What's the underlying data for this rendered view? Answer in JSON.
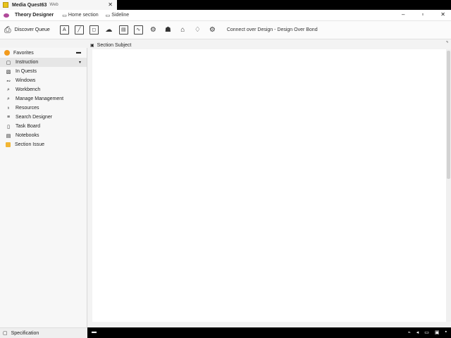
{
  "tab": {
    "title": "Media Quest63",
    "subtitle": "Web",
    "close_icon": "close-icon"
  },
  "menubar": {
    "app_name": "Theory Designer",
    "items": [
      {
        "label": "Home section",
        "icon": "window-icon"
      },
      {
        "label": "Sideline",
        "icon": "window-icon"
      }
    ]
  },
  "toolbar": {
    "new_label": "Discover Queue",
    "status": "Connect over Design - Design Over Bond"
  },
  "sidebar": {
    "header": "Favorites",
    "items": [
      {
        "label": "Instruction",
        "icon": "file-icon"
      },
      {
        "label": "In Quests",
        "icon": "image-icon"
      },
      {
        "label": "Windows",
        "icon": "link-icon"
      },
      {
        "label": "Workbench",
        "icon": "search-icon"
      },
      {
        "label": "Manage Management",
        "icon": "search-icon"
      },
      {
        "label": "Resources",
        "icon": "bell-icon"
      },
      {
        "label": "Search Designer",
        "icon": "bars-icon"
      },
      {
        "label": "Task Board",
        "icon": "doc-icon"
      },
      {
        "label": "Notebooks",
        "icon": "book-icon"
      },
      {
        "label": "Section Issue",
        "icon": "folder-icon"
      }
    ],
    "footer": "Specification"
  },
  "main": {
    "header": "Section Subject"
  }
}
